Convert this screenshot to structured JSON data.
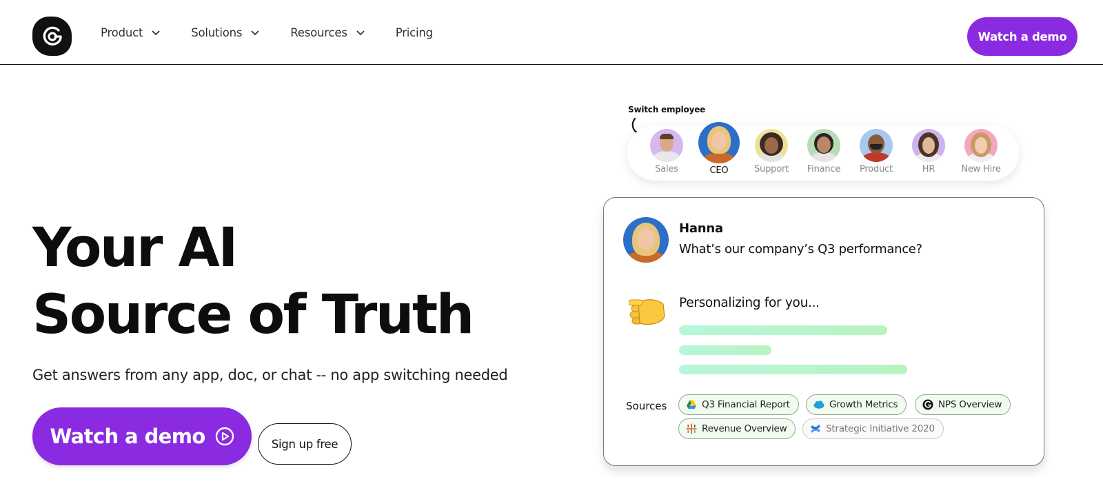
{
  "header": {
    "nav": [
      {
        "label": "Product",
        "has_dropdown": true
      },
      {
        "label": "Solutions",
        "has_dropdown": true
      },
      {
        "label": "Resources",
        "has_dropdown": true
      },
      {
        "label": "Pricing",
        "has_dropdown": false
      }
    ],
    "cta_label": "Watch a demo"
  },
  "hero": {
    "title_line1": "Your AI",
    "title_line2": "Source of Truth",
    "subtitle": "Get answers from any app, doc, or chat -- no app switching needed",
    "primary_cta": "Watch a demo",
    "secondary_cta": "Sign up free"
  },
  "switcher": {
    "label": "Switch employee",
    "employees": [
      {
        "role": "Sales",
        "active": false
      },
      {
        "role": "CEO",
        "active": true
      },
      {
        "role": "Support",
        "active": false
      },
      {
        "role": "Finance",
        "active": false
      },
      {
        "role": "Product",
        "active": false
      },
      {
        "role": "HR",
        "active": false
      },
      {
        "role": "New Hire",
        "active": false
      }
    ]
  },
  "chat": {
    "user_name": "Hanna",
    "question": "What’s our company’s Q3 performance?",
    "status": "Personalizing for you...",
    "sources_label": "Sources",
    "sources": [
      {
        "label": "Q3 Financial Report",
        "icon": "google-drive-icon"
      },
      {
        "label": "Growth Metrics",
        "icon": "salesforce-icon"
      },
      {
        "label": "NPS Overview",
        "icon": "glean-icon"
      },
      {
        "label": "Revenue Overview",
        "icon": "tableau-icon"
      },
      {
        "label": "Strategic Initiative 2020",
        "icon": "confluence-icon"
      }
    ]
  },
  "colors": {
    "brand_purple": "#8a2be2",
    "progress_green": "#b6f7d9",
    "chip_border": "#8fa88f"
  }
}
